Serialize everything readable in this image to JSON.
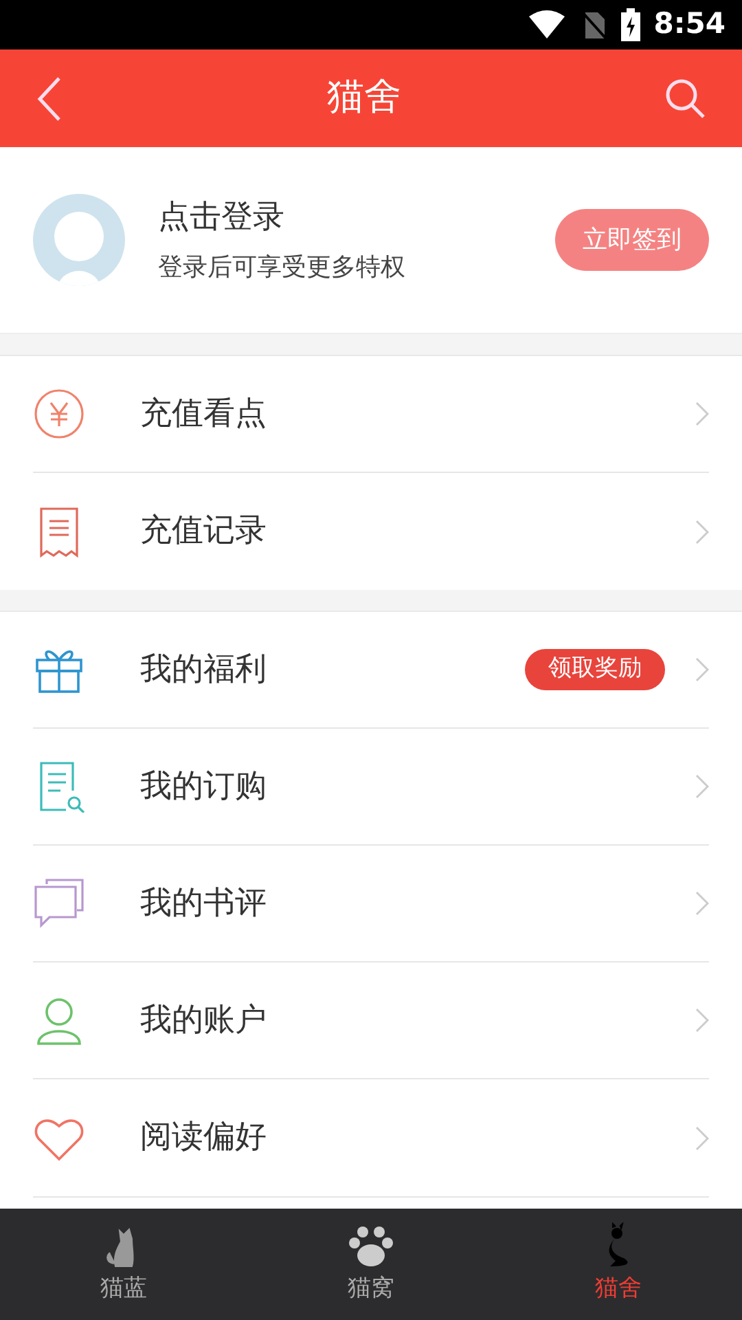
{
  "status_bar": {
    "time": "8:54"
  },
  "header": {
    "title": "猫舍"
  },
  "profile": {
    "name": "点击登录",
    "subtitle": "登录后可享受更多特权",
    "button": "立即签到"
  },
  "groups": [
    {
      "items": [
        {
          "kind": "coin",
          "label": "充值看点"
        },
        {
          "kind": "receipt",
          "label": "充值记录"
        }
      ]
    },
    {
      "items": [
        {
          "kind": "gift",
          "label": "我的福利",
          "badge": "领取奖励"
        },
        {
          "kind": "order",
          "label": "我的订购"
        },
        {
          "kind": "comment",
          "label": "我的书评"
        },
        {
          "kind": "account",
          "label": "我的账户"
        },
        {
          "kind": "heart",
          "label": "阅读偏好"
        }
      ]
    }
  ],
  "tab_bar": [
    {
      "kind": "cat",
      "label": "猫蓝",
      "selected": false
    },
    {
      "kind": "paw",
      "label": "猫窝",
      "selected": false
    },
    {
      "kind": "blackcat",
      "label": "猫舍",
      "selected": true
    }
  ]
}
